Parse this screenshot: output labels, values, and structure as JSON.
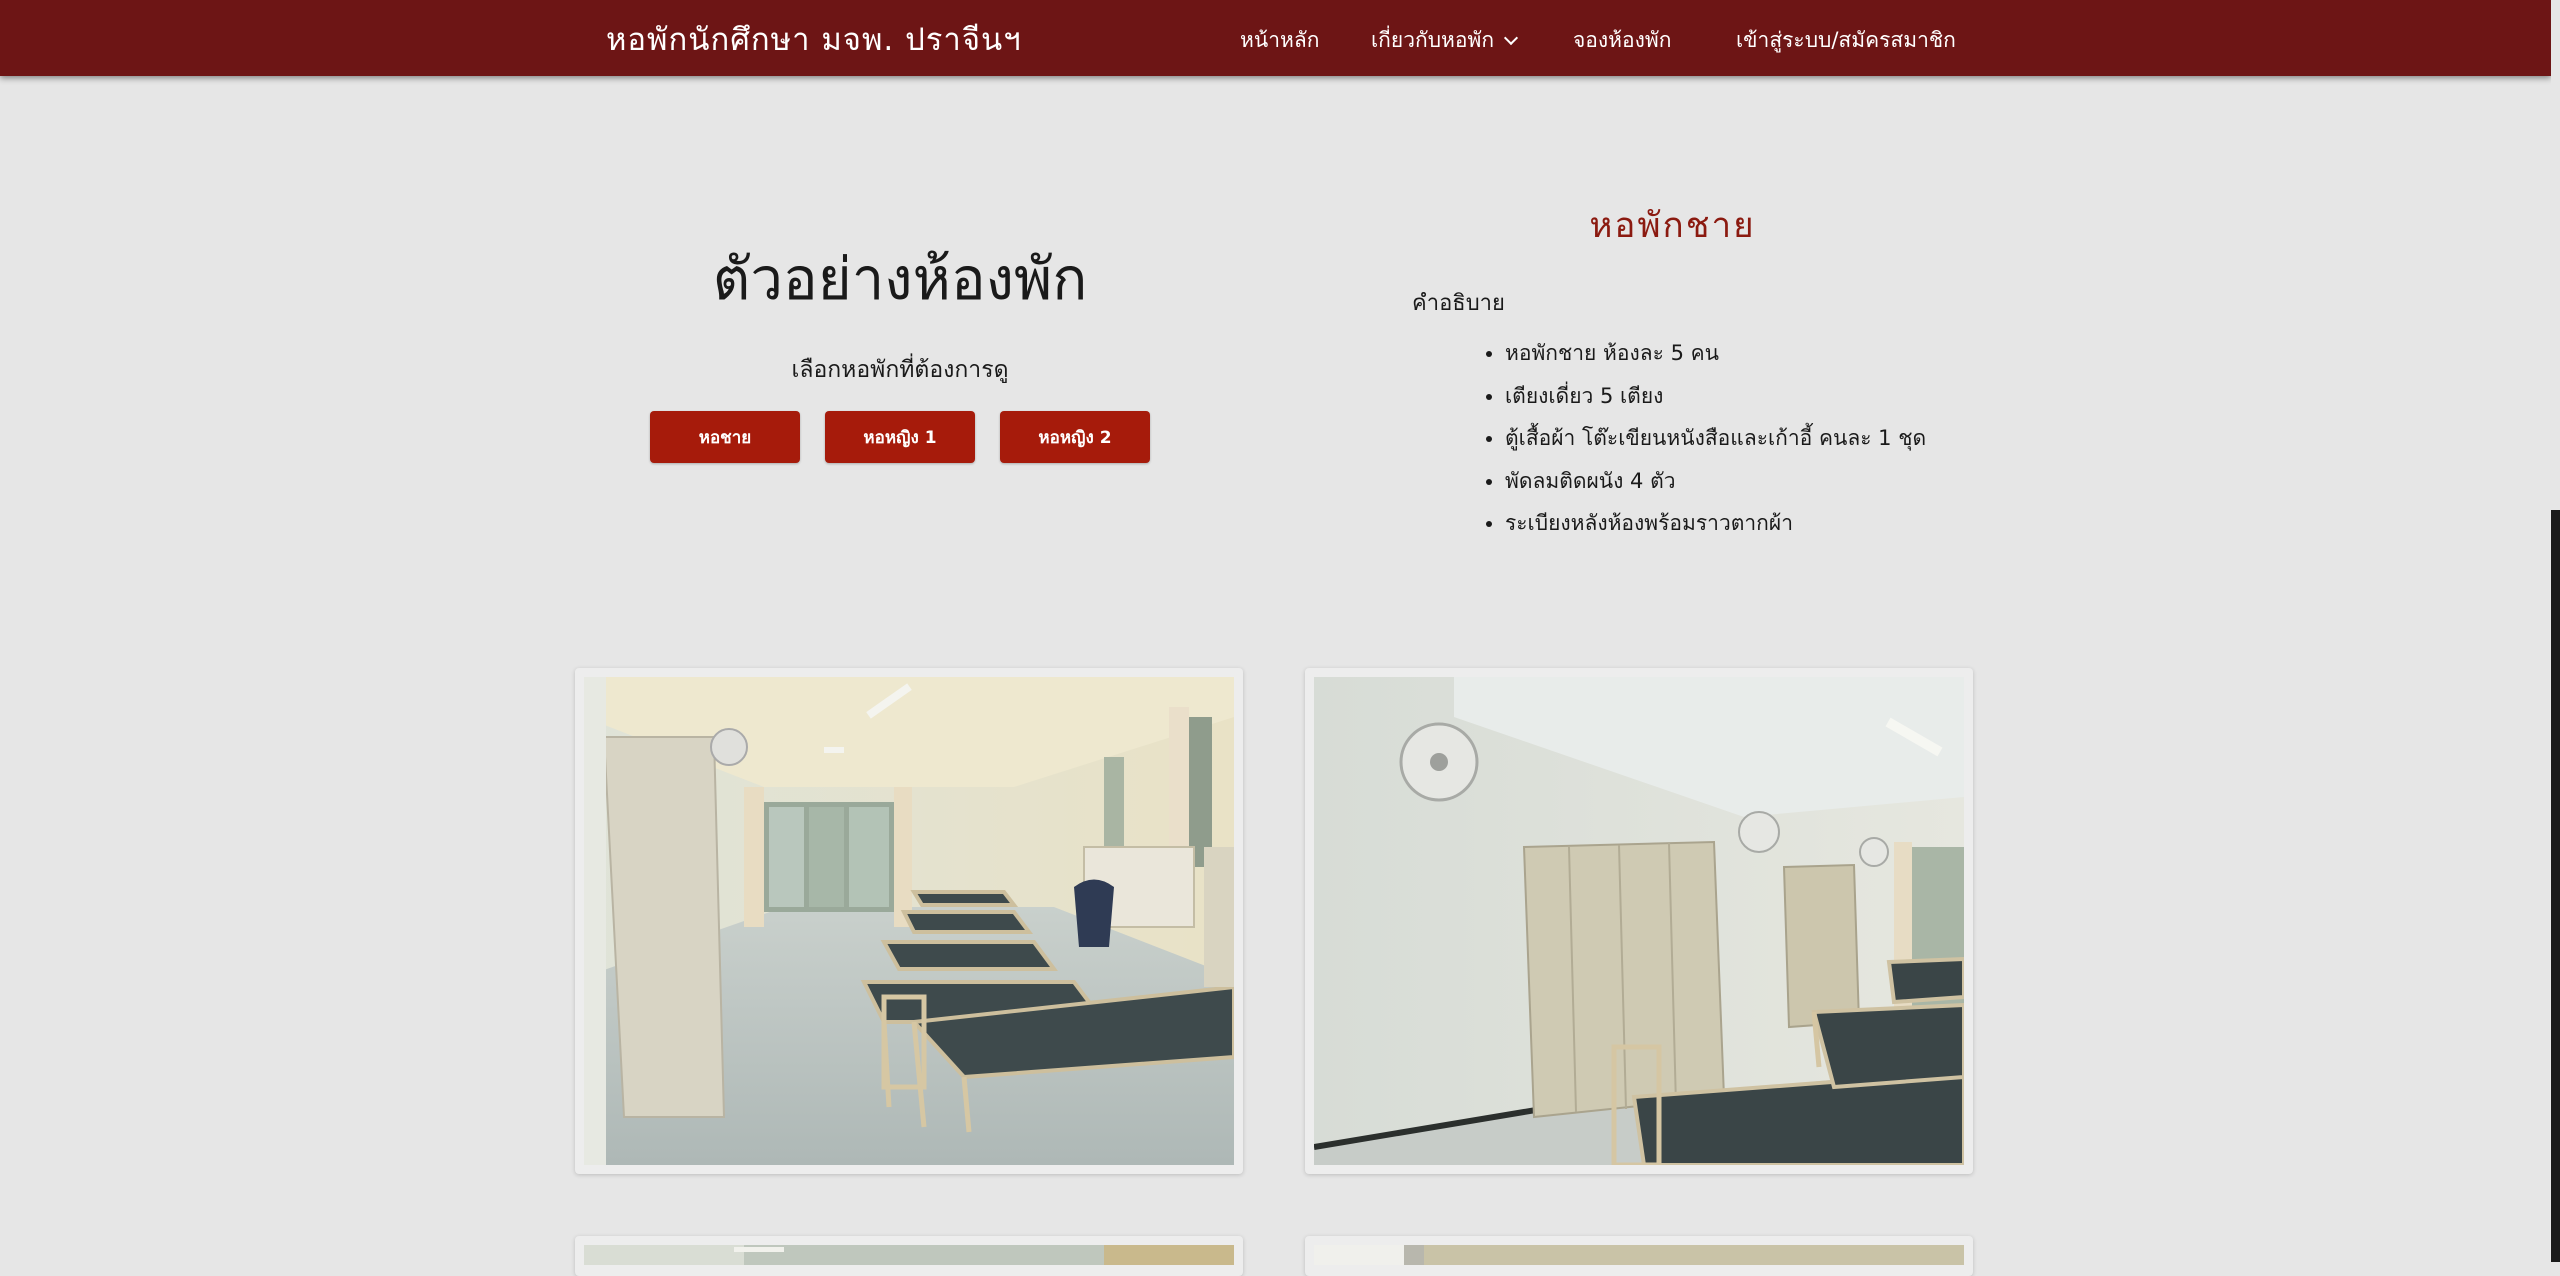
{
  "nav": {
    "brand": "หอพักนักศึกษา มจพ. ปราจีนฯ",
    "items": [
      "หน้าหลัก",
      "เกี่ยวกับหอพัก",
      "จองห้องพัก",
      "เข้าสู่ระบบ/สมัครสมาชิก"
    ]
  },
  "hero": {
    "title": "ตัวอย่างห้องพัก",
    "subtitle": "เลือกหอพักที่ต้องการดู",
    "buttons": [
      "หอชาย",
      "หอหญิง 1",
      "หอหญิง 2"
    ]
  },
  "details": {
    "title": "หอพักชาย",
    "label": "คำอธิบาย",
    "items": [
      "หอพักชาย ห้องละ 5 คน",
      "เตียงเดี่ยว 5 เตียง",
      "ตู้เสื้อผ้า โต๊ะเขียนหนังสือและเก้าอี้ คนละ 1 ชุด",
      "พัดลมติดผนัง 4 ตัว",
      "ระเบียงหลังห้องพร้อมราวตากผ้า"
    ]
  },
  "colors": {
    "navbar": "#6d1515",
    "button": "#a61b0b",
    "title_accent": "#8b1a10",
    "page_bg": "#e6e6e6"
  }
}
